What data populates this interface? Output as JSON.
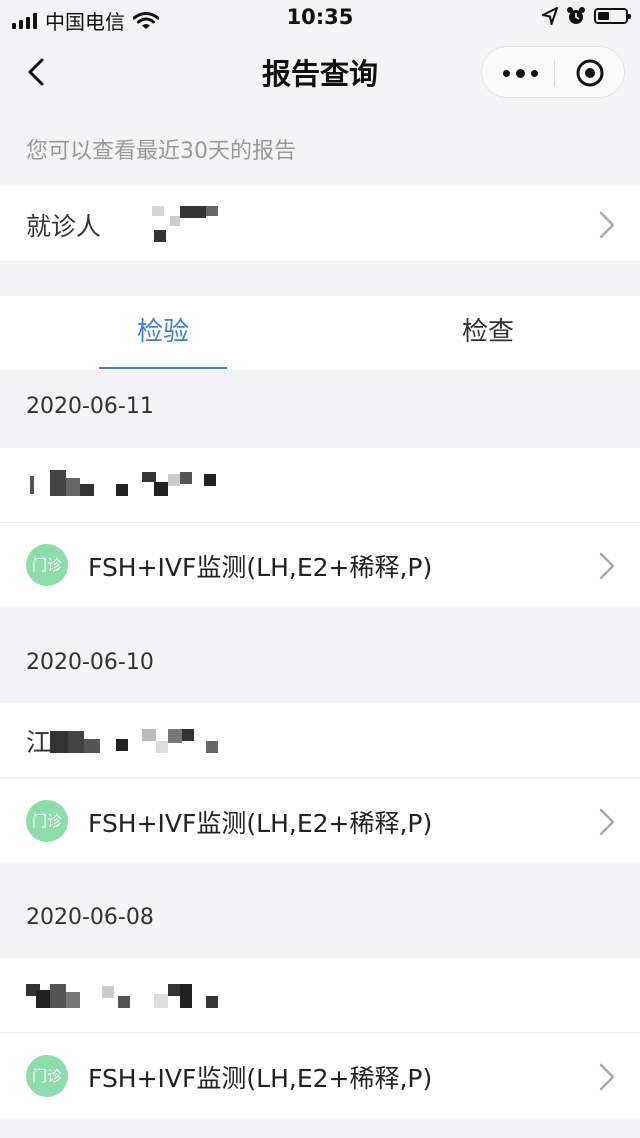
{
  "status_bar": {
    "carrier": "中国电信",
    "time": "10:35",
    "icons": [
      "signal-icon",
      "wifi-icon",
      "location-arrow-icon",
      "alarm-icon",
      "battery-icon"
    ]
  },
  "nav": {
    "title": "报告查询",
    "icons": [
      "back-icon",
      "more-icon",
      "target-icon"
    ]
  },
  "hint": "您可以查看最近30天的报告",
  "patient": {
    "label": "就诊人"
  },
  "tabs": [
    {
      "label": "检验",
      "active": true
    },
    {
      "label": "检查",
      "active": false
    }
  ],
  "groups": [
    {
      "date": "2020-06-11",
      "name_prefix": "",
      "report": {
        "badge": "门诊",
        "title": "FSH+IVF监测(LH,E2+稀释,P)"
      }
    },
    {
      "date": "2020-06-10",
      "name_prefix": "江",
      "report": {
        "badge": "门诊",
        "title": "FSH+IVF监测(LH,E2+稀释,P)"
      }
    },
    {
      "date": "2020-06-08",
      "name_prefix": "",
      "report": {
        "badge": "门诊",
        "title": "FSH+IVF监测(LH,E2+稀释,P)"
      }
    }
  ],
  "colors": {
    "accent": "#3f7fd6",
    "badge": "#8ddcab",
    "background": "#f4f4f6"
  }
}
